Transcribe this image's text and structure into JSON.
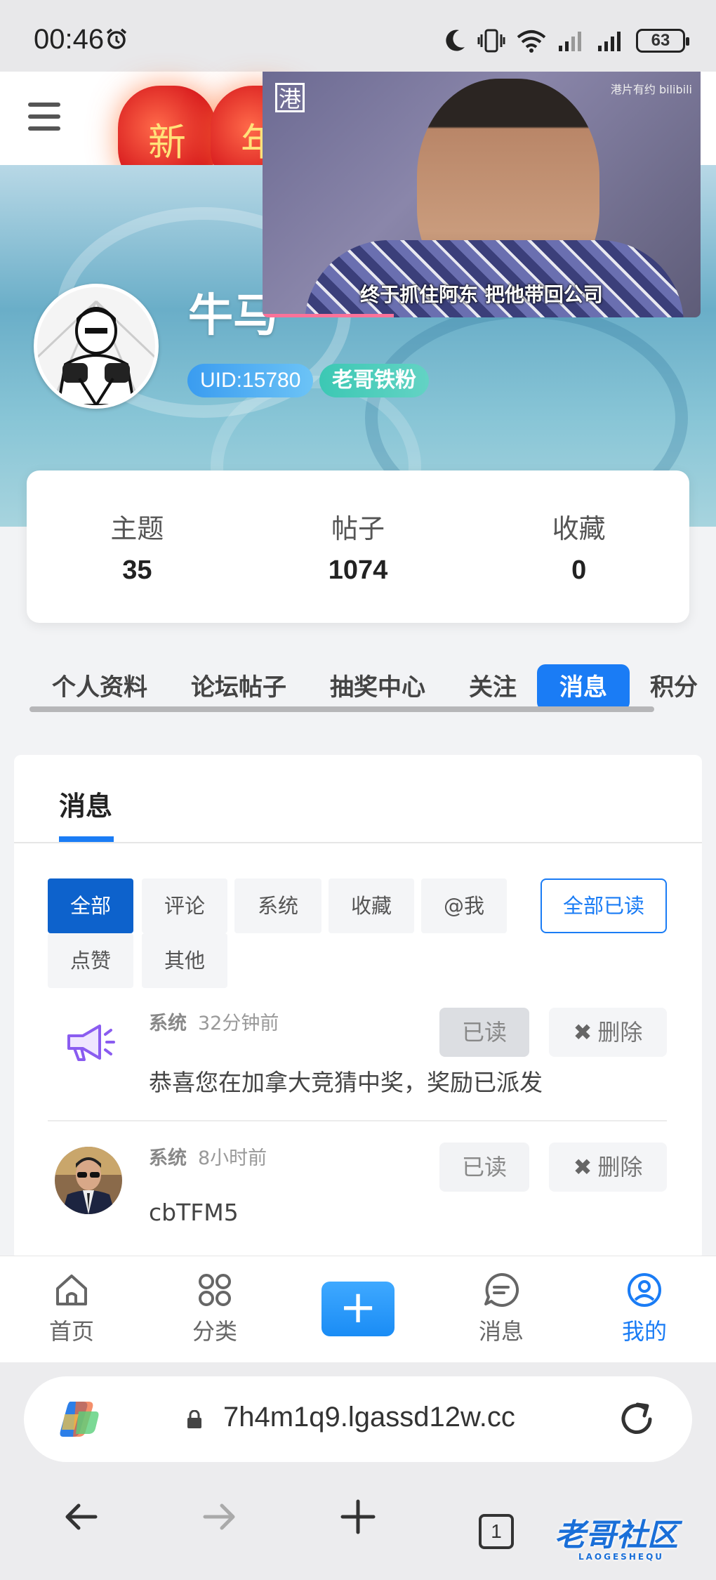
{
  "status_bar": {
    "time": "00:46",
    "battery": "63"
  },
  "header": {
    "lantern_chars": [
      "新",
      "年"
    ]
  },
  "video_pip": {
    "logo": "港",
    "source": "港片有约 bilibili",
    "subtitle": "终于抓住阿东 把他带回公司",
    "progress": 0.3
  },
  "profile": {
    "username": "牛马",
    "uid_badge": "UID:15780",
    "fan_badge": "老哥铁粉"
  },
  "stats": [
    {
      "label": "主题",
      "value": "35"
    },
    {
      "label": "帖子",
      "value": "1074"
    },
    {
      "label": "收藏",
      "value": "0"
    }
  ],
  "profile_tabs": [
    "个人资料",
    "论坛帖子",
    "抽奖中心",
    "关注",
    "消息",
    "积分"
  ],
  "active_profile_tab": "消息",
  "messages_panel": {
    "title": "消息",
    "filters": [
      "全部",
      "评论",
      "系统",
      "收藏",
      "@我",
      "点赞",
      "其他"
    ],
    "active_filter": "全部",
    "mark_all_read": "全部已读",
    "items": [
      {
        "type": "系统",
        "time": "32分钟前",
        "text": "恭喜您在加拿大竞猜中奖，奖励已派发",
        "read_label": "已读",
        "delete_label": "删除",
        "icon": "megaphone-icon"
      },
      {
        "type": "系统",
        "time": "8小时前",
        "text": "cbTFM5",
        "read_label": "已读",
        "delete_label": "删除",
        "icon": "user-avatar"
      }
    ]
  },
  "app_nav": [
    {
      "label": "首页",
      "icon": "home-icon"
    },
    {
      "label": "分类",
      "icon": "grid-icon"
    },
    {
      "label": "消息",
      "icon": "chat-icon"
    },
    {
      "label": "我的",
      "icon": "user-icon"
    }
  ],
  "active_app_nav": "我的",
  "browser": {
    "url": "7h4m1q9.lgassd12w.cc",
    "tab_count": "1"
  },
  "colors": {
    "accent": "#1a7cf5",
    "active_filter": "#0d62cc"
  }
}
